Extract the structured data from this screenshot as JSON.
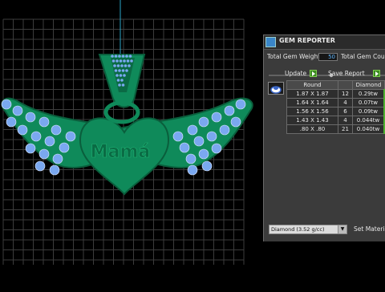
{
  "viewport": {
    "grid_color": "#3c3c3c",
    "model_color": "#0f8a5a",
    "model_dark": "#0a5e3c",
    "gem_color": "#7aa8f0",
    "engraving_text": "Mamá"
  },
  "panel": {
    "title": "GEM REPORTER",
    "total_weight_label": "Total Gem Weight",
    "total_weight_value": "50",
    "total_count_label": "Total Gem Count",
    "update_label": "Update",
    "save_label": "Save Report",
    "table": {
      "headers": [
        "Round",
        "",
        "Diamond"
      ],
      "rows": [
        {
          "size": "1.87 X 1.87",
          "count": "12",
          "weight": "0.29tw"
        },
        {
          "size": "1.64 X 1.64",
          "count": "4",
          "weight": "0.07tw"
        },
        {
          "size": "1.56 X 1.56",
          "count": "6",
          "weight": "0.09tw"
        },
        {
          "size": "1.43 X 1.43",
          "count": "4",
          "weight": "0.044tw"
        },
        {
          "size": ".80 X .80",
          "count": "21",
          "weight": "0.040tw"
        }
      ]
    },
    "material_select": "Diamond    (3.52 g/cc)",
    "set_material_label": "Set Materia"
  }
}
